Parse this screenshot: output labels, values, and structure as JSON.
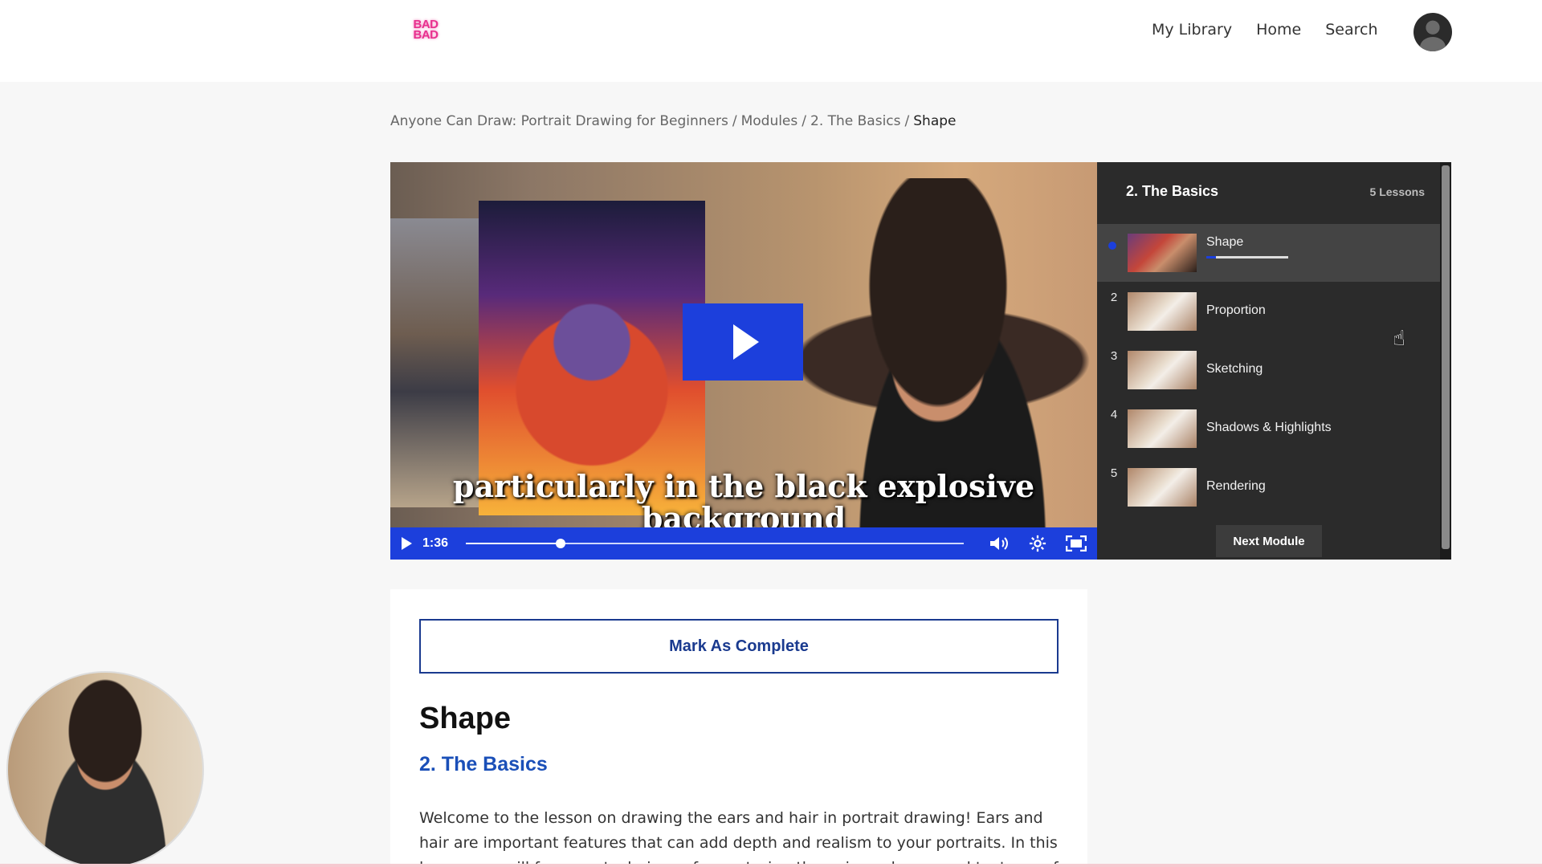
{
  "header": {
    "logo_line1": "BAD",
    "logo_line2": "BAD",
    "nav": [
      "My Library",
      "Home",
      "Search"
    ]
  },
  "breadcrumb": {
    "items": [
      "Anyone Can Draw: Portrait Drawing for Beginners",
      "Modules",
      "2. The Basics"
    ],
    "current": "Shape",
    "separator": "/"
  },
  "video": {
    "caption_line1": "particularly in the black explosive",
    "caption_line2": "background",
    "time": "1:36",
    "progress": 0.19,
    "accent_color": "#1c3fdc"
  },
  "panel": {
    "title": "2. The Basics",
    "count": "5 Lessons",
    "lessons": [
      {
        "num": "",
        "label": "Shape",
        "active": true,
        "progress": 0.12
      },
      {
        "num": "2",
        "label": "Proportion"
      },
      {
        "num": "3",
        "label": "Sketching"
      },
      {
        "num": "4",
        "label": "Shadows & Highlights"
      },
      {
        "num": "5",
        "label": "Rendering"
      }
    ],
    "next_label": "Next Module"
  },
  "content": {
    "complete_label": "Mark As Complete",
    "title": "Shape",
    "module": "2. The Basics",
    "description": "Welcome to the lesson on drawing the ears and hair in portrait drawing! Ears and hair are important features that can add depth and realism to your portraits. In this lesson, we will focus on techniques for capturing the unique shapes and textures of ears and"
  },
  "icons": {
    "play": "play-icon",
    "volume": "volume-icon",
    "settings": "gear-icon",
    "fullscreen": "fullscreen-icon",
    "avatar": "user-avatar-icon"
  }
}
